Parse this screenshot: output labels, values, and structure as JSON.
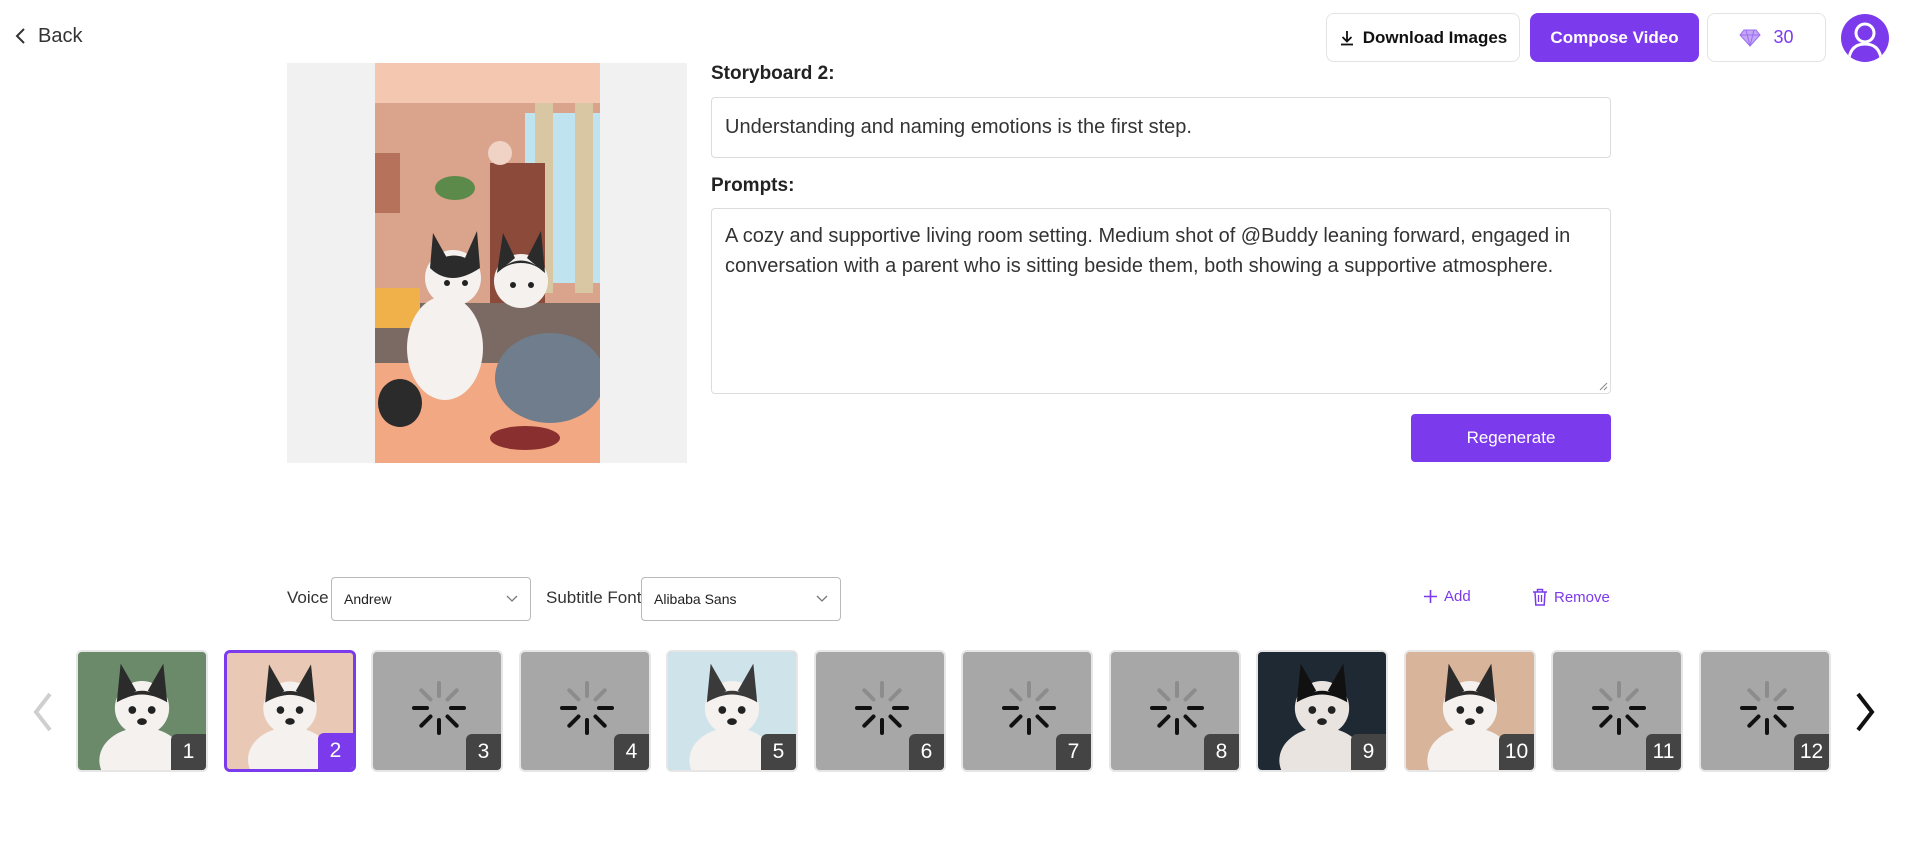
{
  "header": {
    "back_label": "Back",
    "download_label": "Download Images",
    "compose_label": "Compose Video",
    "credits": "30"
  },
  "storyboard": {
    "title": "Storyboard 2:",
    "caption": "Understanding and naming emotions is the first step.",
    "prompts_label": "Prompts:",
    "prompt": "A cozy and supportive living room setting. Medium shot of @Buddy leaning forward, engaged in conversation with a parent who is sitting beside them, both showing a supportive atmosphere.",
    "regenerate_label": "Regenerate"
  },
  "controls": {
    "voice_label": "Voice",
    "voice_value": "Andrew",
    "font_label": "Subtitle Font",
    "font_value": "Alibaba Sans",
    "add_label": "Add",
    "remove_label": "Remove"
  },
  "filmstrip": {
    "selected": 2,
    "items": [
      {
        "num": "1",
        "state": "image"
      },
      {
        "num": "2",
        "state": "image"
      },
      {
        "num": "3",
        "state": "loading"
      },
      {
        "num": "4",
        "state": "loading"
      },
      {
        "num": "5",
        "state": "image"
      },
      {
        "num": "6",
        "state": "loading"
      },
      {
        "num": "7",
        "state": "loading"
      },
      {
        "num": "8",
        "state": "loading"
      },
      {
        "num": "9",
        "state": "image"
      },
      {
        "num": "10",
        "state": "image"
      },
      {
        "num": "11",
        "state": "loading"
      },
      {
        "num": "12",
        "state": "loading"
      }
    ]
  },
  "colors": {
    "accent": "#7c3aed",
    "placeholder": "#a7a7a7"
  }
}
